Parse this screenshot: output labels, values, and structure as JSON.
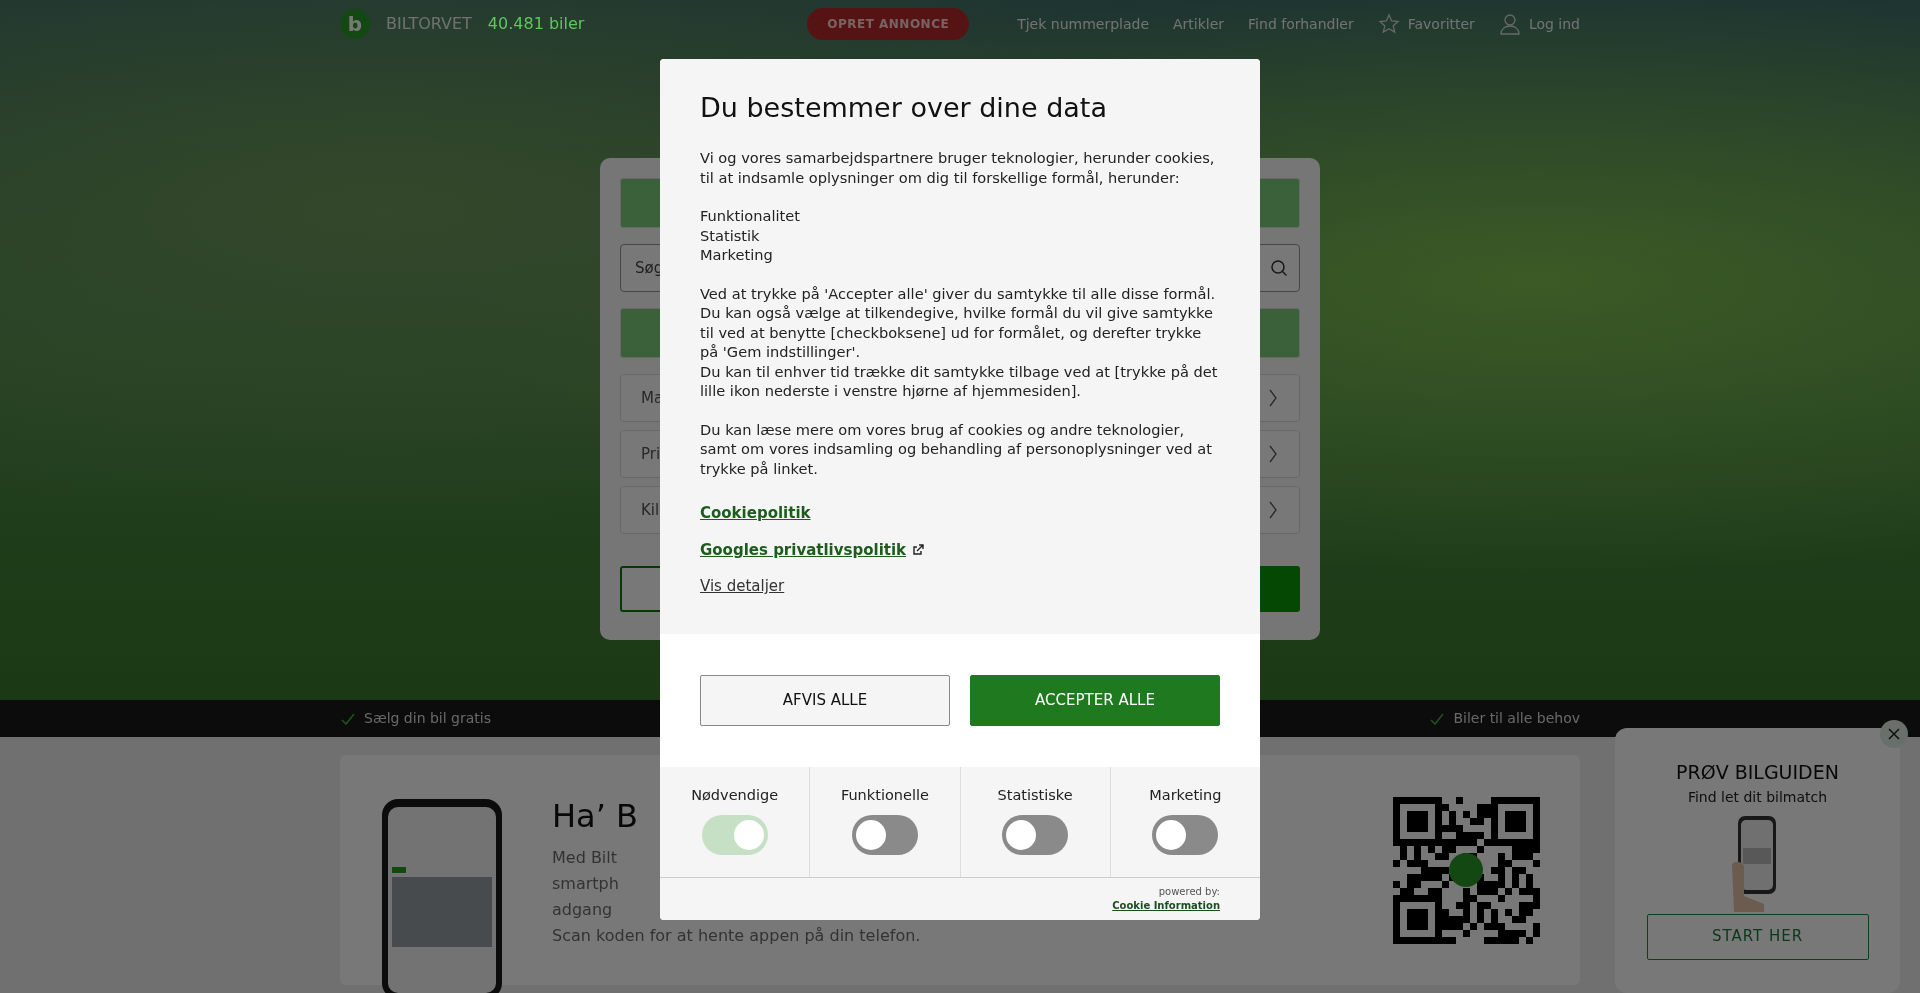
{
  "header": {
    "logo_letter": "b",
    "brand": "BILTORVET",
    "count": "40.481 biler",
    "cta": "OPRET ANNONCE",
    "nav": [
      {
        "label": "Tjek nummerplade",
        "kind": "text"
      },
      {
        "label": "Artikler",
        "kind": "text"
      },
      {
        "label": "Find forhandler",
        "kind": "text"
      },
      {
        "label": "Favoritter",
        "kind": "star"
      },
      {
        "label": "Log ind",
        "kind": "user"
      }
    ]
  },
  "search_panel": {
    "search_placeholder": "Søg",
    "fields": [
      "Ma",
      "Pri",
      "Kil"
    ]
  },
  "usp_bar": [
    "Sælg din bil gratis",
    "Biler til alle behov"
  ],
  "app_promo": {
    "heading": "Ha’ B",
    "lines": [
      "Med Bilt",
      "smartph",
      "adgang",
      "Scan koden for at hente appen på din telefon."
    ]
  },
  "guide_popup": {
    "title": "PRØV BILGUIDEN",
    "subtitle": "Find let dit bilmatch",
    "button": "START HER"
  },
  "consent": {
    "title": "Du bestemmer over dine data",
    "blocks": [
      {
        "lines": [
          "Vi og vores samarbejdspartnere bruger teknologier, herunder cookies, til at indsamle oplysninger om dig til forskellige formål, herunder:"
        ]
      },
      {
        "lines": [
          "Funktionalitet",
          "Statistik",
          "Marketing"
        ]
      },
      {
        "lines": [
          "Ved at trykke på 'Accepter alle' giver du samtykke til alle disse formål. Du kan også vælge at tilkendegive, hvilke formål du vil give samtykke til ved at benytte [checkboksene] ud for formålet, og derefter trykke på 'Gem indstillinger'.",
          "Du kan til enhver tid trække dit samtykke tilbage ved at [trykke på det lille ikon nederste i venstre hjørne af hjemmesiden]."
        ]
      },
      {
        "lines": [
          "Du kan læse mere om vores brug af cookies og andre teknologier, samt om vores indsamling og behandling af personoplysninger ved at trykke på linket."
        ]
      }
    ],
    "links": [
      {
        "label": "Cookiepolitik",
        "kind": "policy"
      },
      {
        "label": "Googles privatlivspolitik",
        "kind": "external"
      },
      {
        "label": "Vis detaljer",
        "kind": "details"
      }
    ],
    "buttons": [
      {
        "label": "AFVIS ALLE",
        "kind": "secondary"
      },
      {
        "label": "ACCEPTER ALLE",
        "kind": "primary"
      }
    ],
    "categories": [
      {
        "label": "Nødvendige",
        "on": true,
        "disabled": true
      },
      {
        "label": "Funktionelle",
        "on": false,
        "disabled": false
      },
      {
        "label": "Statistiske",
        "on": false,
        "disabled": false
      },
      {
        "label": "Marketing",
        "on": false,
        "disabled": false
      }
    ],
    "powered_by": "powered by:",
    "provider": "Cookie Information"
  }
}
